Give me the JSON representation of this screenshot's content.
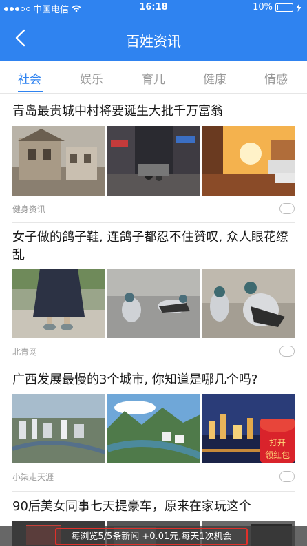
{
  "status_bar": {
    "carrier": "中国电信",
    "time": "16:18",
    "battery_text": "10%",
    "battery_level": 0.1
  },
  "nav": {
    "title": "百姓资讯",
    "back_icon": "chevron-left-icon"
  },
  "tabs": [
    {
      "label": "社会",
      "active": true
    },
    {
      "label": "娱乐",
      "active": false
    },
    {
      "label": "育儿",
      "active": false
    },
    {
      "label": "健康",
      "active": false
    },
    {
      "label": "情感",
      "active": false
    }
  ],
  "articles": [
    {
      "title": "青岛最贵城中村将要诞生大批千万富翁",
      "source": "健身资讯"
    },
    {
      "title": "女子做的鸽子鞋, 连鸽子都忍不住赞叹, 众人眼花缭乱",
      "source": "北青网"
    },
    {
      "title": "广西发展最慢的3个城市, 你知道是哪几个吗?",
      "source": "小柒走天涯"
    },
    {
      "title": "90后美女同事七天提豪车，原来在家玩这个",
      "source": ""
    }
  ],
  "red_packet": {
    "line1": "打开",
    "line2": "领红包"
  },
  "bottom_banner": {
    "text": "每浏览5/5条新闻 +0.01元,每天1次机会"
  },
  "colors": {
    "brand": "#2f83f0",
    "red": "#d9232b"
  }
}
